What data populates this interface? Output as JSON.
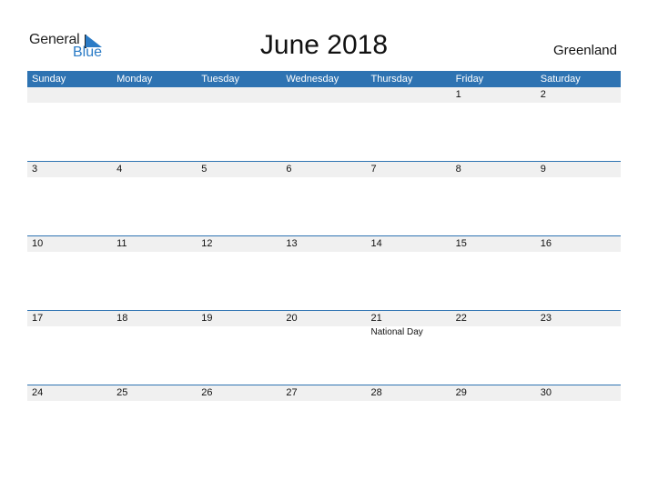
{
  "logo": {
    "text_general": "General",
    "text_blue": "Blue",
    "brand_color": "#2a7bc6"
  },
  "title": "June 2018",
  "region": "Greenland",
  "header_color": "#2e73b2",
  "weekdays": [
    "Sunday",
    "Monday",
    "Tuesday",
    "Wednesday",
    "Thursday",
    "Friday",
    "Saturday"
  ],
  "weeks": [
    {
      "days": [
        "",
        "",
        "",
        "",
        "",
        "1",
        "2"
      ],
      "events": [
        "",
        "",
        "",
        "",
        "",
        "",
        ""
      ]
    },
    {
      "days": [
        "3",
        "4",
        "5",
        "6",
        "7",
        "8",
        "9"
      ],
      "events": [
        "",
        "",
        "",
        "",
        "",
        "",
        ""
      ]
    },
    {
      "days": [
        "10",
        "11",
        "12",
        "13",
        "14",
        "15",
        "16"
      ],
      "events": [
        "",
        "",
        "",
        "",
        "",
        "",
        ""
      ]
    },
    {
      "days": [
        "17",
        "18",
        "19",
        "20",
        "21",
        "22",
        "23"
      ],
      "events": [
        "",
        "",
        "",
        "",
        "National Day",
        "",
        ""
      ]
    },
    {
      "days": [
        "24",
        "25",
        "26",
        "27",
        "28",
        "29",
        "30"
      ],
      "events": [
        "",
        "",
        "",
        "",
        "",
        "",
        ""
      ]
    }
  ]
}
